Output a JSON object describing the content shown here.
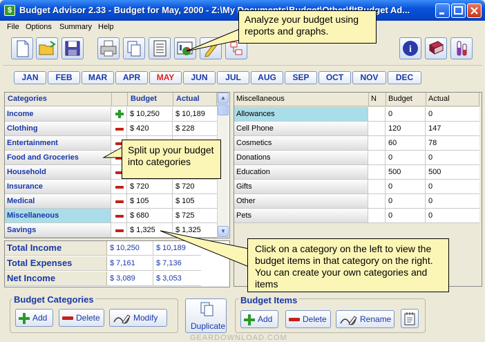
{
  "window": {
    "title": "Budget Advisor 2.33 -  Budget for May, 2000  - Z:\\My Documents\\Budget\\Other\\fltBudget Ad..."
  },
  "menu": [
    "File",
    "Options",
    "Summary",
    "Help"
  ],
  "toolbar": [
    "new-file-icon",
    "open-folder-icon",
    "save-icon",
    "print-icon",
    "copy-icon",
    "list-icon",
    "chart-icon",
    "pencil-icon",
    "transfer-icon",
    "info-icon",
    "book-icon",
    "test-tube-icon"
  ],
  "months": [
    "JAN",
    "FEB",
    "MAR",
    "APR",
    "MAY",
    "JUN",
    "JUL",
    "AUG",
    "SEP",
    "OCT",
    "NOV",
    "DEC"
  ],
  "active_month": "MAY",
  "categories": {
    "headers": {
      "name": "Categories",
      "budget": "Budget",
      "actual": "Actual"
    },
    "rows": [
      {
        "name": "Income",
        "sign": "plus",
        "budget": "$ 10,250",
        "actual": "$ 10,189"
      },
      {
        "name": "Clothing",
        "sign": "minus",
        "budget": "$ 420",
        "actual": "$ 228"
      },
      {
        "name": "Entertainment",
        "sign": "minus",
        "budget": "",
        "actual": ""
      },
      {
        "name": "Food and Groceries",
        "sign": "minus",
        "budget": "",
        "actual": ""
      },
      {
        "name": "Household",
        "sign": "minus",
        "budget": "",
        "actual": ""
      },
      {
        "name": "Insurance",
        "sign": "minus",
        "budget": "$ 720",
        "actual": "$ 720"
      },
      {
        "name": "Medical",
        "sign": "minus",
        "budget": "$ 105",
        "actual": "$ 105"
      },
      {
        "name": "Miscellaneous",
        "sign": "minus",
        "budget": "$ 680",
        "actual": "$ 725"
      },
      {
        "name": "Savings",
        "sign": "minus",
        "budget": "$ 1,325",
        "actual": "$ 1,325"
      }
    ],
    "selected": "Miscellaneous"
  },
  "totals": [
    {
      "label": "Total Income",
      "budget": "$ 10,250",
      "actual": "$ 10,189"
    },
    {
      "label": "Total Expenses",
      "budget": "$ 7,161",
      "actual": "$ 7,136"
    },
    {
      "label": "Net Income",
      "budget": "$ 3,089",
      "actual": "$ 3,053"
    }
  ],
  "items": {
    "headers": {
      "name": "Miscellaneous",
      "n": "N",
      "budget": "Budget",
      "actual": "Actual"
    },
    "rows": [
      {
        "name": "Allowances",
        "budget": "0",
        "actual": "0"
      },
      {
        "name": "Cell Phone",
        "budget": "120",
        "actual": "147"
      },
      {
        "name": "Cosmetics",
        "budget": "60",
        "actual": "78"
      },
      {
        "name": "Donations",
        "budget": "0",
        "actual": "0"
      },
      {
        "name": "Education",
        "budget": "500",
        "actual": "500"
      },
      {
        "name": "Gifts",
        "budget": "0",
        "actual": "0"
      },
      {
        "name": "Other",
        "budget": "0",
        "actual": "0"
      },
      {
        "name": "Pets",
        "budget": "0",
        "actual": "0"
      }
    ],
    "selected": "Allowances"
  },
  "budget_categories": {
    "title": "Budget Categories",
    "add": "Add",
    "delete": "Delete",
    "modify": "Modify"
  },
  "duplicate_label": "Duplicate",
  "budget_items": {
    "title": "Budget Items",
    "add": "Add",
    "delete": "Delete",
    "rename": "Rename"
  },
  "callouts": {
    "reports": "Analyze your budget using reports and graphs.",
    "categories": "Split up your budget into categories",
    "items": "Click on a category on the left to view the budget items in that category on the right. You can create your own categories and items"
  },
  "watermark": "GEARDOWNLOAD.COM",
  "colors": {
    "title_bar": "#0a53d8",
    "selected_row": "#a9dde9",
    "label_blue": "#1838a8",
    "active_month": "#e02020",
    "callout_bg": "#fcf6b6"
  }
}
